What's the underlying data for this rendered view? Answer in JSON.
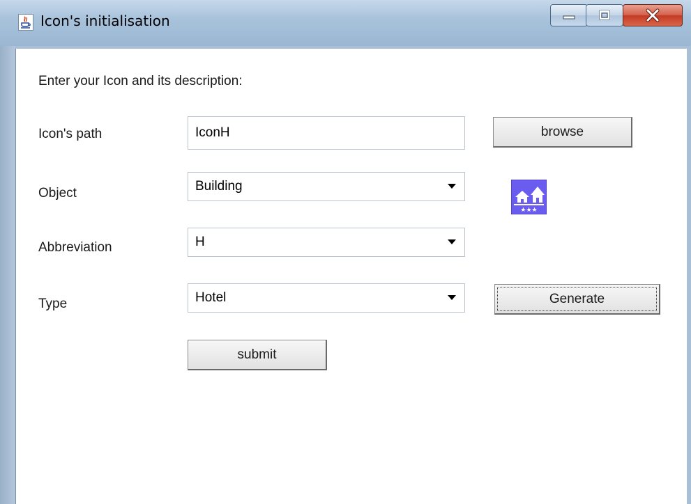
{
  "window": {
    "title": "Icon's initialisation",
    "controls": [
      "minimize",
      "maximize",
      "close"
    ]
  },
  "form": {
    "heading": "Enter your Icon and its description:",
    "icon_path": {
      "label": "Icon's path",
      "value": "IconH",
      "browse_label": "browse"
    },
    "object": {
      "label": "Object",
      "selected": "Building"
    },
    "abbreviation": {
      "label": "Abbreviation",
      "selected": "H"
    },
    "type": {
      "label": "Type",
      "selected": "Hotel",
      "generate_label": "Generate"
    },
    "submit_label": "submit"
  },
  "preview": {
    "icon": "hotel-building-icon",
    "color": "#6b5cf0"
  },
  "colors": {
    "titlebar": "#a9c3dc",
    "close_button": "#c23a22",
    "client_bg": "#ffffff"
  }
}
